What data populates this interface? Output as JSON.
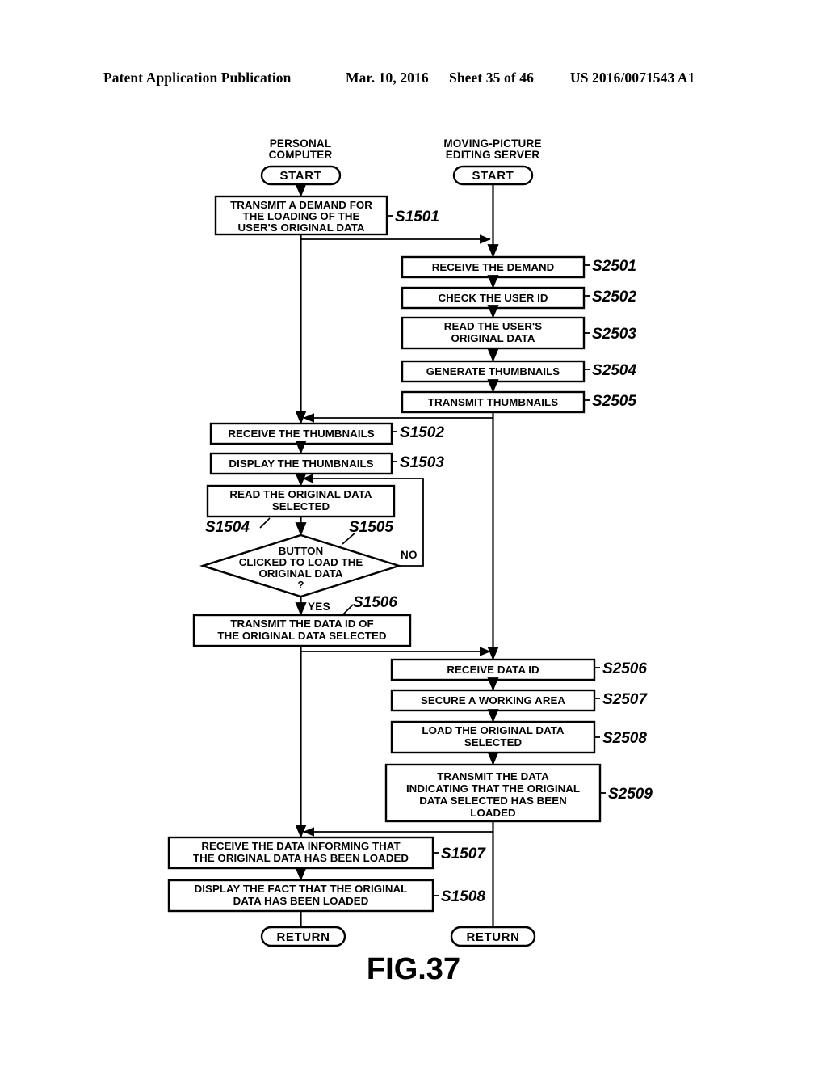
{
  "header": {
    "publication": "Patent Application Publication",
    "date": "Mar. 10, 2016",
    "sheet": "Sheet 35 of 46",
    "number": "US 2016/0071543 A1"
  },
  "figure": {
    "caption": "FIG.37"
  },
  "lanes": {
    "left": {
      "title_line1": "PERSONAL",
      "title_line2": "COMPUTER",
      "start": "START",
      "end": "RETURN"
    },
    "right": {
      "title_line1": "MOVING-PICTURE",
      "title_line2": "EDITING SERVER",
      "start": "START",
      "end": "RETURN"
    }
  },
  "branches": {
    "yes": "YES",
    "no": "NO"
  },
  "pc_steps": [
    {
      "id": "S1501",
      "lines": [
        "TRANSMIT A DEMAND FOR",
        "THE LOADING OF THE",
        "USER'S ORIGINAL DATA"
      ]
    },
    {
      "id": "S1502",
      "lines": [
        "RECEIVE THE THUMBNAILS"
      ]
    },
    {
      "id": "S1503",
      "lines": [
        "DISPLAY THE THUMBNAILS"
      ]
    },
    {
      "id": "S1504",
      "lines": [
        "READ THE ORIGINAL DATA",
        "SELECTED"
      ]
    },
    {
      "id": "S1505",
      "lines": [
        "BUTTON",
        "CLICKED TO LOAD THE",
        "ORIGINAL DATA",
        "?"
      ]
    },
    {
      "id": "S1506",
      "lines": [
        "TRANSMIT THE DATA ID OF",
        "THE ORIGINAL DATA SELECTED"
      ]
    },
    {
      "id": "S1507",
      "lines": [
        "RECEIVE THE DATA INFORMING THAT",
        "THE ORIGINAL DATA HAS BEEN LOADED"
      ]
    },
    {
      "id": "S1508",
      "lines": [
        "DISPLAY THE FACT THAT THE ORIGINAL",
        "DATA HAS BEEN LOADED"
      ]
    }
  ],
  "server_steps": [
    {
      "id": "S2501",
      "lines": [
        "RECEIVE THE DEMAND"
      ]
    },
    {
      "id": "S2502",
      "lines": [
        "CHECK THE USER ID"
      ]
    },
    {
      "id": "S2503",
      "lines": [
        "READ THE USER'S",
        "ORIGINAL DATA"
      ]
    },
    {
      "id": "S2504",
      "lines": [
        "GENERATE THUMBNAILS"
      ]
    },
    {
      "id": "S2505",
      "lines": [
        "TRANSMIT THUMBNAILS"
      ]
    },
    {
      "id": "S2506",
      "lines": [
        "RECEIVE DATA ID"
      ]
    },
    {
      "id": "S2507",
      "lines": [
        "SECURE A WORKING AREA"
      ]
    },
    {
      "id": "S2508",
      "lines": [
        "LOAD THE ORIGINAL DATA",
        "SELECTED"
      ]
    },
    {
      "id": "S2509",
      "lines": [
        "TRANSMIT THE DATA",
        "INDICATING THAT THE ORIGINAL",
        "DATA SELECTED HAS BEEN",
        "LOADED"
      ]
    }
  ]
}
